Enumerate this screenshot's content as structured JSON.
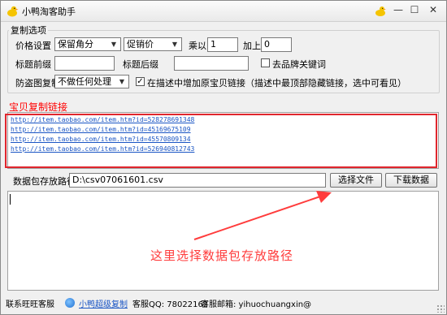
{
  "window": {
    "title": "小鸭淘客助手",
    "buttons": {
      "minimize": "—",
      "maximize": "☐",
      "close": "✕"
    }
  },
  "options": {
    "group_title": "复制选项",
    "price_label": "价格设置",
    "price_rounding": "保留角分",
    "price_type": "促销价",
    "multiply_label": "乘以",
    "multiply_value": "1",
    "add_label": "加上",
    "add_value": "0",
    "title_prefix_label": "标题前缀",
    "title_prefix_value": "",
    "title_suffix_label": "标题后缀",
    "title_suffix_value": "",
    "remove_sensitive_label": "去品牌关键词",
    "remove_sensitive_checked": false,
    "anti_theft_label": "防盗图复制",
    "anti_theft_value": "不做任何处理",
    "add_original_link_label": "在描述中增加原宝贝链接（描述中最顶部隐藏链接，选中可看见）",
    "add_original_link_checked": true
  },
  "links": {
    "title": "宝贝复制链接",
    "items": [
      "http://item.taobao.com/item.htm?id=528278691348",
      "http://item.taobao.com/item.htm?id=45169675109",
      "http://item.taobao.com/item.htm?id=45570809134",
      "http://item.taobao.com/item.htm?id=526940812743"
    ]
  },
  "path": {
    "label": "数据包存放路径",
    "value": "D:\\csv07061601.csv",
    "choose_button": "选择文件",
    "download_button": "下载数据"
  },
  "annotation": {
    "text": "这里选择数据包存放路径",
    "color": "#ff3c3c"
  },
  "status": {
    "contact_label": "联系旺旺客服",
    "copy_link": "小鸭超级复制",
    "qq": "客服QQ: 78022162",
    "email": "客服邮箱: yihuochuangxin@"
  },
  "colors": {
    "highlight_border": "#e0262d",
    "link": "#1a55c4",
    "section_title": "#ff0000"
  }
}
